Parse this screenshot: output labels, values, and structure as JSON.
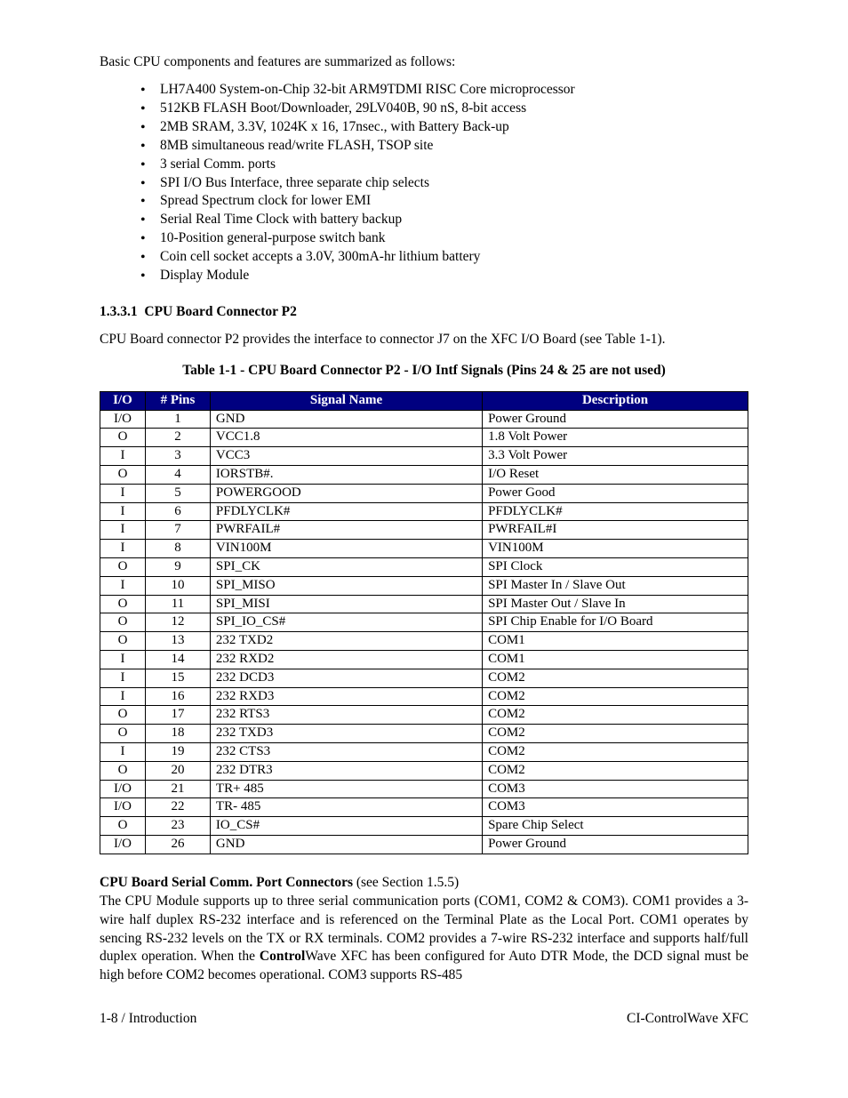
{
  "intro": "Basic CPU components and features are summarized as follows:",
  "features": [
    "LH7A400 System-on-Chip 32-bit ARM9TDMI RISC Core microprocessor",
    "512KB FLASH Boot/Downloader, 29LV040B, 90 nS, 8-bit access",
    "2MB SRAM, 3.3V, 1024K x 16, 17nsec., with Battery Back-up",
    "8MB simultaneous read/write FLASH, TSOP site",
    "3 serial Comm. ports",
    "SPI I/O Bus Interface, three separate chip selects",
    "Spread Spectrum clock for lower EMI",
    "Serial Real Time Clock with battery backup",
    "10-Position general-purpose switch bank",
    "Coin cell socket accepts a 3.0V, 300mA-hr lithium battery",
    "Display Module"
  ],
  "section": {
    "number": "1.3.3.1",
    "title": "CPU Board Connector P2",
    "body": "CPU Board connector P2 provides the interface to connector J7 on the XFC I/O Board (see Table 1-1)."
  },
  "table": {
    "title": "Table 1-1 - CPU Board Connector P2 - I/O Intf Signals (Pins 24 & 25 are not used)",
    "headers": [
      "I/O",
      "# Pins",
      "Signal Name",
      "Description"
    ],
    "rows": [
      [
        "I/O",
        "1",
        "GND",
        "Power Ground"
      ],
      [
        "O",
        "2",
        "VCC1.8",
        "1.8 Volt Power"
      ],
      [
        "I",
        "3",
        "VCC3",
        "3.3 Volt Power"
      ],
      [
        "O",
        "4",
        "IORSTB#.",
        "I/O Reset"
      ],
      [
        "I",
        "5",
        "POWERGOOD",
        "Power Good"
      ],
      [
        "I",
        "6",
        "PFDLYCLK#",
        "PFDLYCLK#"
      ],
      [
        "I",
        "7",
        "PWRFAIL#",
        "PWRFAIL#I"
      ],
      [
        "I",
        "8",
        "VIN100M",
        "VIN100M"
      ],
      [
        "O",
        "9",
        "SPI_CK",
        "SPI Clock"
      ],
      [
        "I",
        "10",
        "SPI_MISO",
        "SPI Master In / Slave Out"
      ],
      [
        "O",
        "11",
        "SPI_MISI",
        "SPI Master Out / Slave In"
      ],
      [
        "O",
        "12",
        "SPI_IO_CS#",
        "SPI Chip Enable for I/O Board"
      ],
      [
        "O",
        "13",
        "232 TXD2",
        "COM1"
      ],
      [
        "I",
        "14",
        "232 RXD2",
        "COM1"
      ],
      [
        "I",
        "15",
        "232 DCD3",
        "COM2"
      ],
      [
        "I",
        "16",
        "232 RXD3",
        "COM2"
      ],
      [
        "O",
        "17",
        "232 RTS3",
        "COM2"
      ],
      [
        "O",
        "18",
        "232 TXD3",
        "COM2"
      ],
      [
        "I",
        "19",
        "232 CTS3",
        "COM2"
      ],
      [
        "O",
        "20",
        "232 DTR3",
        "COM2"
      ],
      [
        "I/O",
        "21",
        "TR+ 485",
        "COM3"
      ],
      [
        "I/O",
        "22",
        "TR- 485",
        "COM3"
      ],
      [
        "O",
        "23",
        "IO_CS#",
        "Spare Chip Select"
      ],
      [
        "I/O",
        "26",
        "GND",
        "Power Ground"
      ]
    ]
  },
  "serial": {
    "heading": "CPU Board Serial Comm. Port Connectors",
    "heading_note": " (see Section 1.5.5)",
    "body_pre": "The CPU Module supports up to three serial communication ports (COM1, COM2 & COM3). COM1 provides a 3-wire half duplex RS-232 interface and is referenced on the Terminal Plate as the Local Port. COM1 operates by sencing RS-232 levels on the TX or RX terminals. COM2 provides a 7-wire RS-232 interface and supports half/full duplex operation. When the ",
    "body_bold": "Control",
    "body_post": "Wave XFC has been configured for Auto DTR Mode, the DCD signal must be high before COM2 becomes operational. COM3 supports RS-485"
  },
  "footer": {
    "left": "1-8 / Introduction",
    "right": "CI-ControlWave XFC"
  }
}
